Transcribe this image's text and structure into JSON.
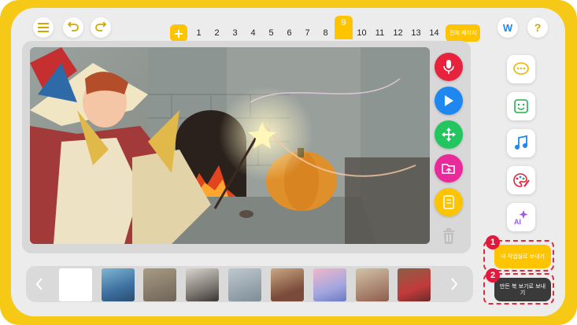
{
  "toolbar": {
    "menu_icon": "menu-icon",
    "undo_icon": "undo-icon",
    "redo_icon": "redo-icon",
    "brand_icon": "w-logo-icon",
    "help_icon": "help-icon",
    "help_glyph": "?",
    "brand_glyph": "W"
  },
  "pages": {
    "add_label": "+",
    "items": [
      "1",
      "2",
      "3",
      "4",
      "5",
      "6",
      "7",
      "8",
      "9",
      "10",
      "11",
      "12",
      "13",
      "14"
    ],
    "current": "9",
    "all_pages_label": "전체 페이지"
  },
  "tools": [
    {
      "name": "record",
      "icon": "microphone-icon",
      "color": "#e8223c"
    },
    {
      "name": "play",
      "icon": "play-icon",
      "color": "#1e88f0"
    },
    {
      "name": "move",
      "icon": "move-icon",
      "color": "#22c55e"
    },
    {
      "name": "open",
      "icon": "folder-open-icon",
      "color": "#e82a9a"
    },
    {
      "name": "document",
      "icon": "document-icon",
      "color": "#ffc400"
    },
    {
      "name": "delete",
      "icon": "trash-icon",
      "color": "#bdbdbd"
    }
  ],
  "side_buttons": [
    {
      "name": "speech-bubble",
      "icon": "speech-bubble-icon"
    },
    {
      "name": "sticker",
      "icon": "sticker-icon"
    },
    {
      "name": "music",
      "icon": "music-note-icon"
    },
    {
      "name": "palette",
      "icon": "palette-icon"
    },
    {
      "name": "ai",
      "icon": "ai-sparkle-icon",
      "label": "AI"
    }
  ],
  "send": {
    "my_workroom_label": "내 작업실로 보내기",
    "book_view_label": "만든 북 보기로 보내기",
    "badge_1": "1",
    "badge_2": "2"
  },
  "filmstrip": {
    "prev_icon": "chevron-left-icon",
    "next_icon": "chevron-right-icon",
    "thumbs": [
      "blank",
      "scene-2",
      "scene-3",
      "scene-4",
      "scene-5",
      "scene-6",
      "scene-7",
      "scene-8",
      "scene-9"
    ]
  },
  "colors": {
    "brand_yellow": "#f7c917",
    "accent_red": "#e02a3c"
  }
}
